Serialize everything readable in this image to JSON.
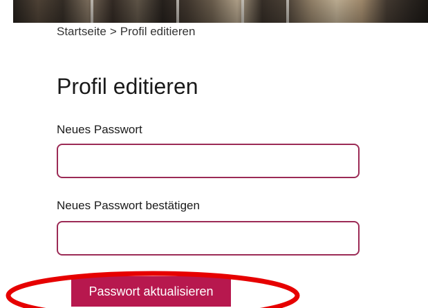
{
  "breadcrumb": {
    "home": "Startseite",
    "separator": ">",
    "current": "Profil editieren"
  },
  "page_title": "Profil editieren",
  "form": {
    "new_password": {
      "label": "Neues Passwort",
      "value": ""
    },
    "confirm_password": {
      "label": "Neues Passwort bestätigen",
      "value": ""
    },
    "submit_label": "Passwort aktualisieren"
  },
  "colors": {
    "accent": "#b7184e",
    "input_border": "#9b2a55",
    "highlight": "#e60000"
  }
}
